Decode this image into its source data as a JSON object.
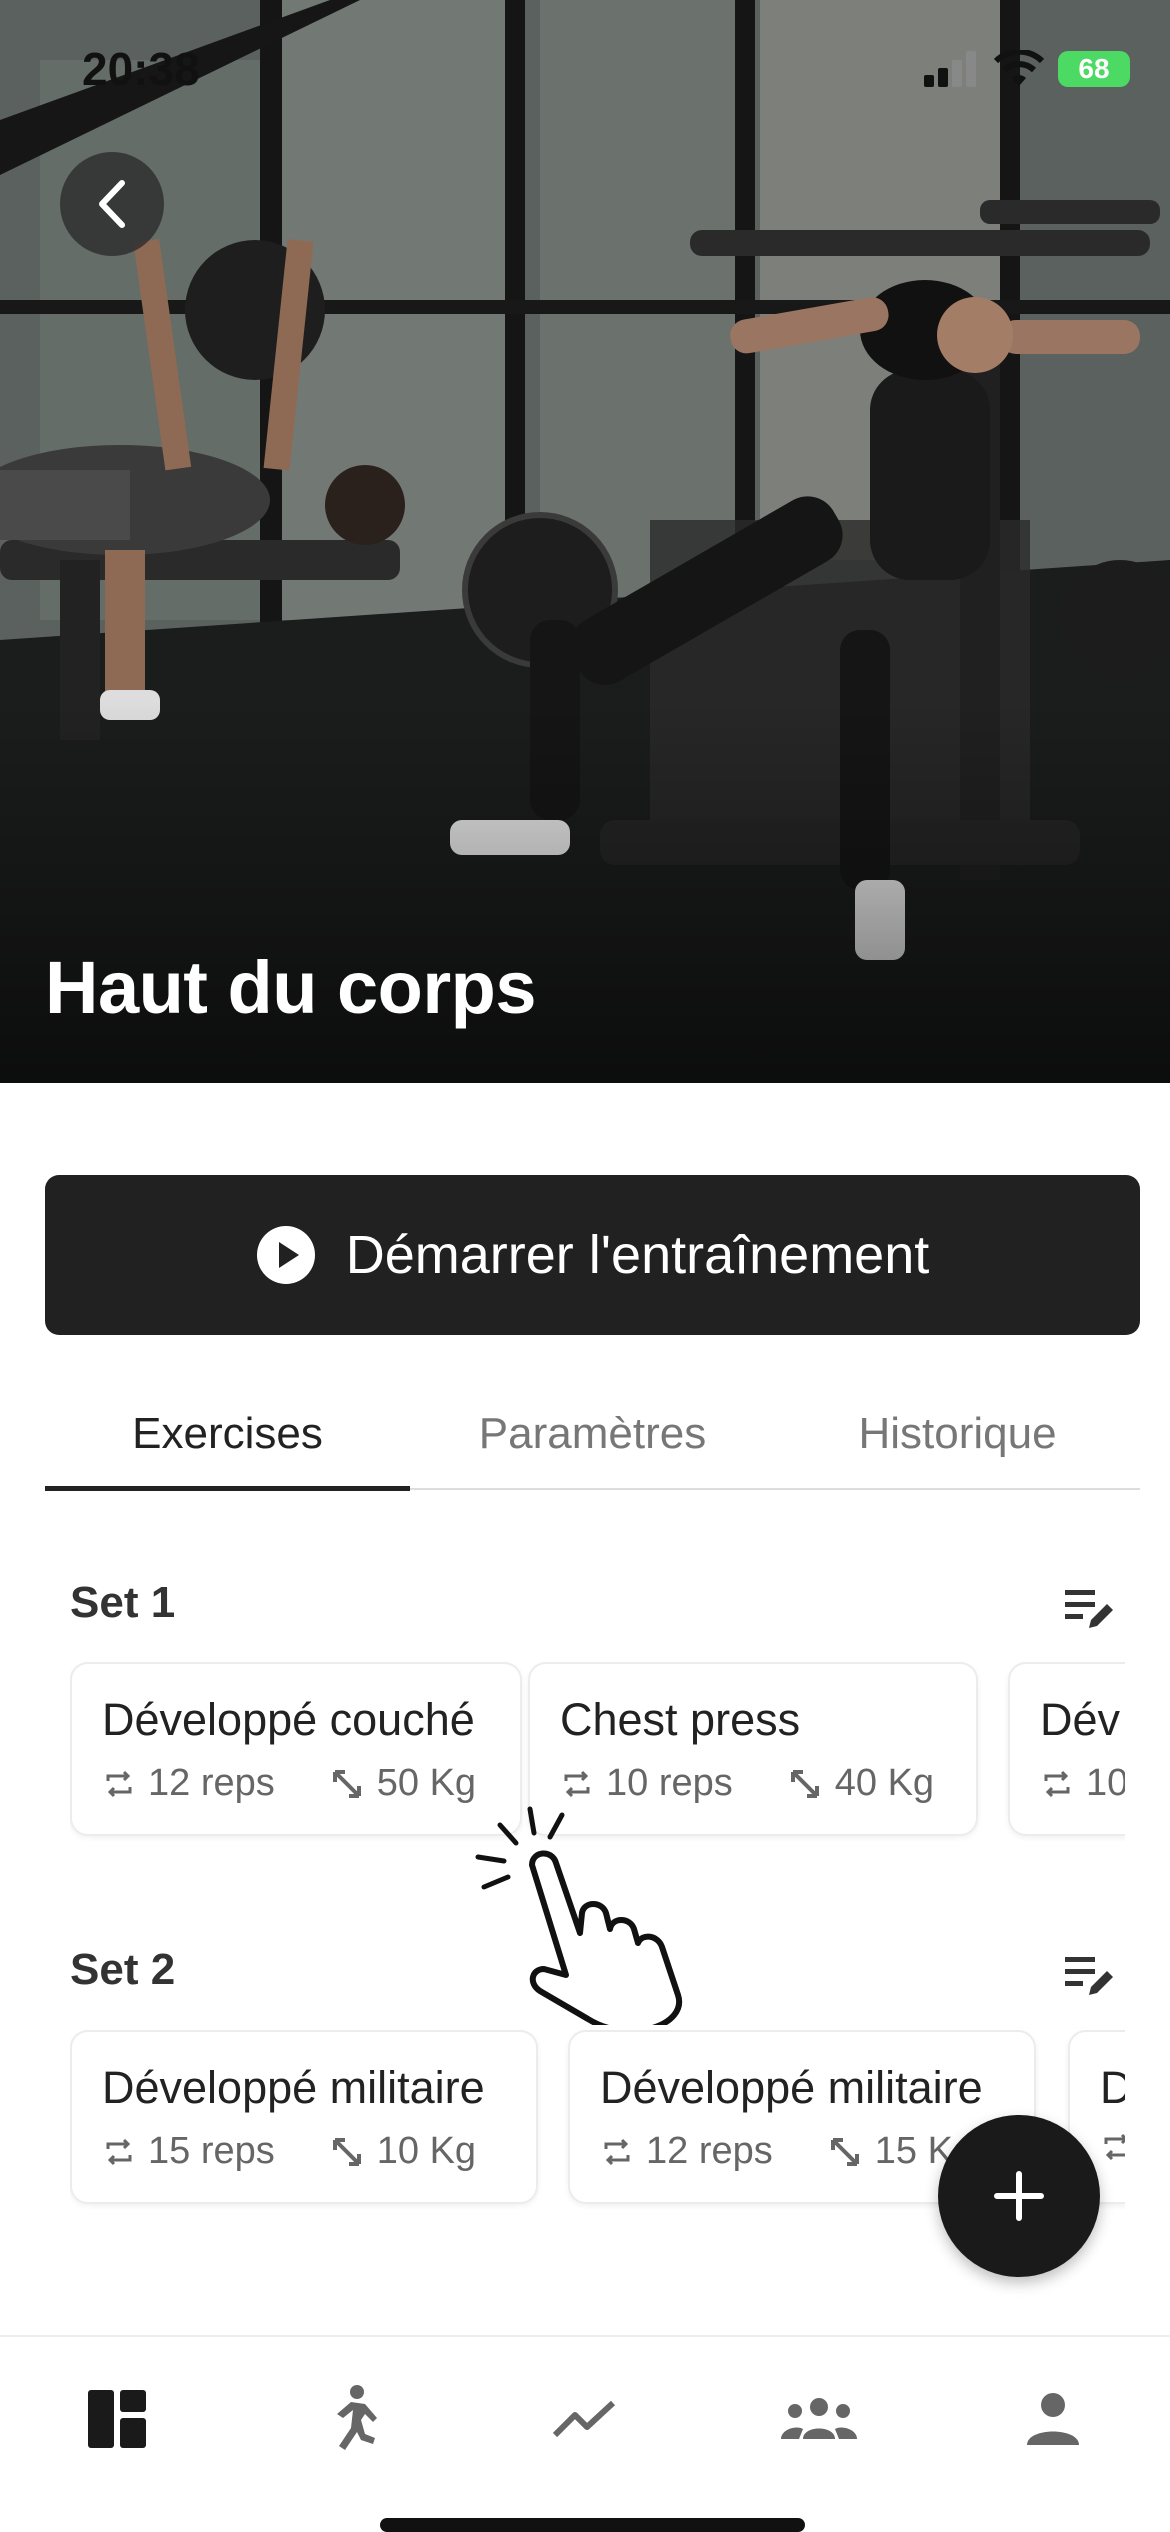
{
  "status_bar": {
    "time": "20:38",
    "battery": "68"
  },
  "hero": {
    "title": "Haut du corps"
  },
  "start_button": {
    "label": "Démarrer l'entraînement"
  },
  "tabs": [
    {
      "label": "Exercises",
      "active": true
    },
    {
      "label": "Paramètres",
      "active": false
    },
    {
      "label": "Historique",
      "active": false
    }
  ],
  "sets": [
    {
      "title": "Set 1",
      "exercises": [
        {
          "name": "Développé couché",
          "reps": "12 reps",
          "weight": "50 Kg"
        },
        {
          "name": "Chest press",
          "reps": "10 reps",
          "weight": "40 Kg"
        },
        {
          "name": "Dév",
          "reps": "10",
          "weight": ""
        }
      ]
    },
    {
      "title": "Set 2",
      "exercises": [
        {
          "name": "Développé militaire",
          "reps": "15 reps",
          "weight": "10 Kg"
        },
        {
          "name": "Développé militaire",
          "reps": "12 reps",
          "weight": "15 Kg"
        },
        {
          "name": "D",
          "reps": "",
          "weight": ""
        }
      ]
    }
  ],
  "bottom_nav": [
    {
      "icon": "dashboard-icon",
      "active": true
    },
    {
      "icon": "running-icon",
      "active": false
    },
    {
      "icon": "chart-line-icon",
      "active": false
    },
    {
      "icon": "group-icon",
      "active": false
    },
    {
      "icon": "person-icon",
      "active": false
    }
  ],
  "colors": {
    "dark_button": "#212121",
    "fab": "#1a1a1a",
    "battery": "#4cd964"
  }
}
